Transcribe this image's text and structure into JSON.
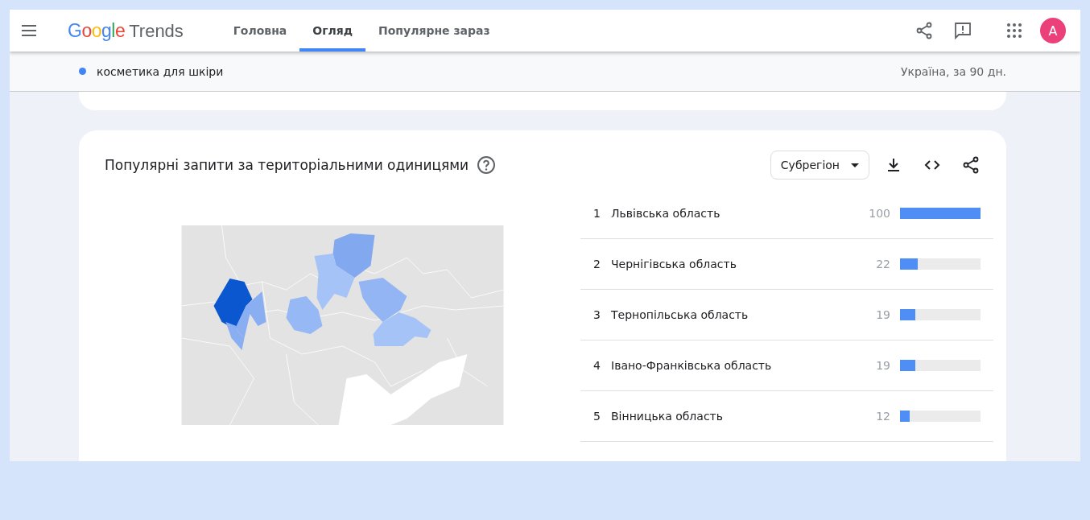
{
  "header": {
    "logo": {
      "brand": "Google",
      "product": "Trends"
    },
    "tabs": [
      {
        "label": "Головна",
        "selected": false
      },
      {
        "label": "Огляд",
        "selected": true
      },
      {
        "label": "Популярне зараз",
        "selected": false
      }
    ],
    "avatar": "A"
  },
  "query_bar": {
    "term": "косметика для шкіри",
    "color": "#4285f4",
    "scope": "Україна, за 90 дн."
  },
  "region_card": {
    "title": "Популярні запити за територіальними одиницями",
    "resolution": "Субрегіон",
    "rows": [
      {
        "rank": "1",
        "name": "Львівська область",
        "value": "100",
        "level": 1.0
      },
      {
        "rank": "2",
        "name": "Чернігівська область",
        "value": "22",
        "level": 0.22
      },
      {
        "rank": "3",
        "name": "Тернопільська область",
        "value": "19",
        "level": 0.19
      },
      {
        "rank": "4",
        "name": "Івано-Франківська область",
        "value": "19",
        "level": 0.19
      },
      {
        "rank": "5",
        "name": "Вінницька область",
        "value": "12",
        "level": 0.12
      }
    ]
  }
}
